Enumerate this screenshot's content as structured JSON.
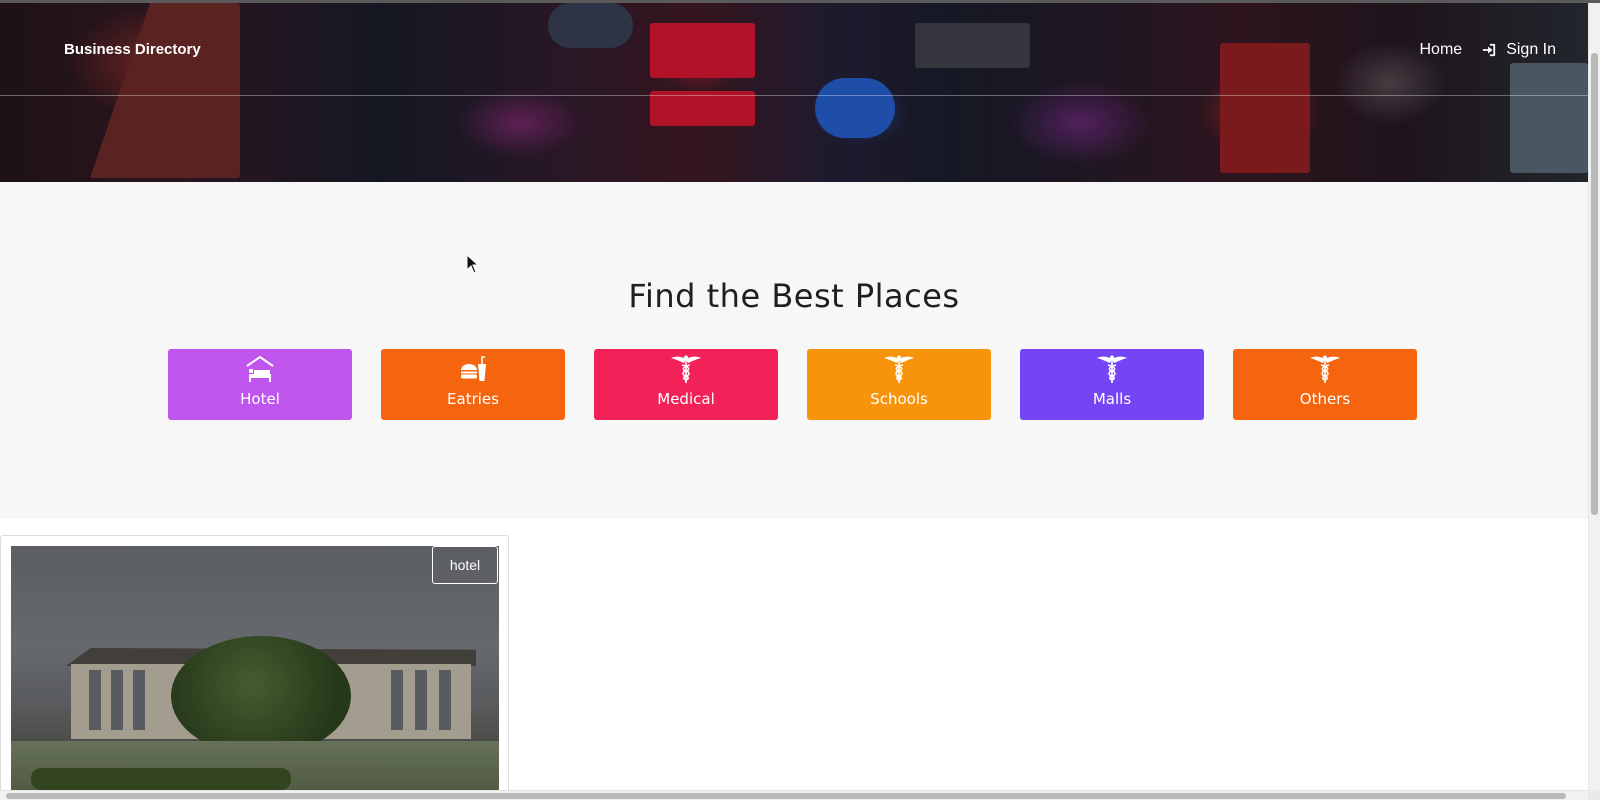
{
  "header": {
    "brand": "Business Directory",
    "nav": {
      "home": "Home",
      "sign_in": "Sign In",
      "sign_in_icon": "sign-in-icon"
    }
  },
  "categories": {
    "title": "Find the Best Places",
    "items": [
      {
        "label": "Hotel",
        "icon": "bed-icon",
        "color": "#bf55ec"
      },
      {
        "label": "Eatries",
        "icon": "fast-food-icon",
        "color": "#f5640e"
      },
      {
        "label": "Medical",
        "icon": "caduceus-icon",
        "color": "#f22158"
      },
      {
        "label": "Schools",
        "icon": "caduceus-icon",
        "color": "#f7940b"
      },
      {
        "label": "Malls",
        "icon": "caduceus-icon",
        "color": "#7545f5"
      },
      {
        "label": "Others",
        "icon": "caduceus-icon",
        "color": "#f5640e"
      }
    ]
  },
  "listing": {
    "badge": "hotel"
  }
}
